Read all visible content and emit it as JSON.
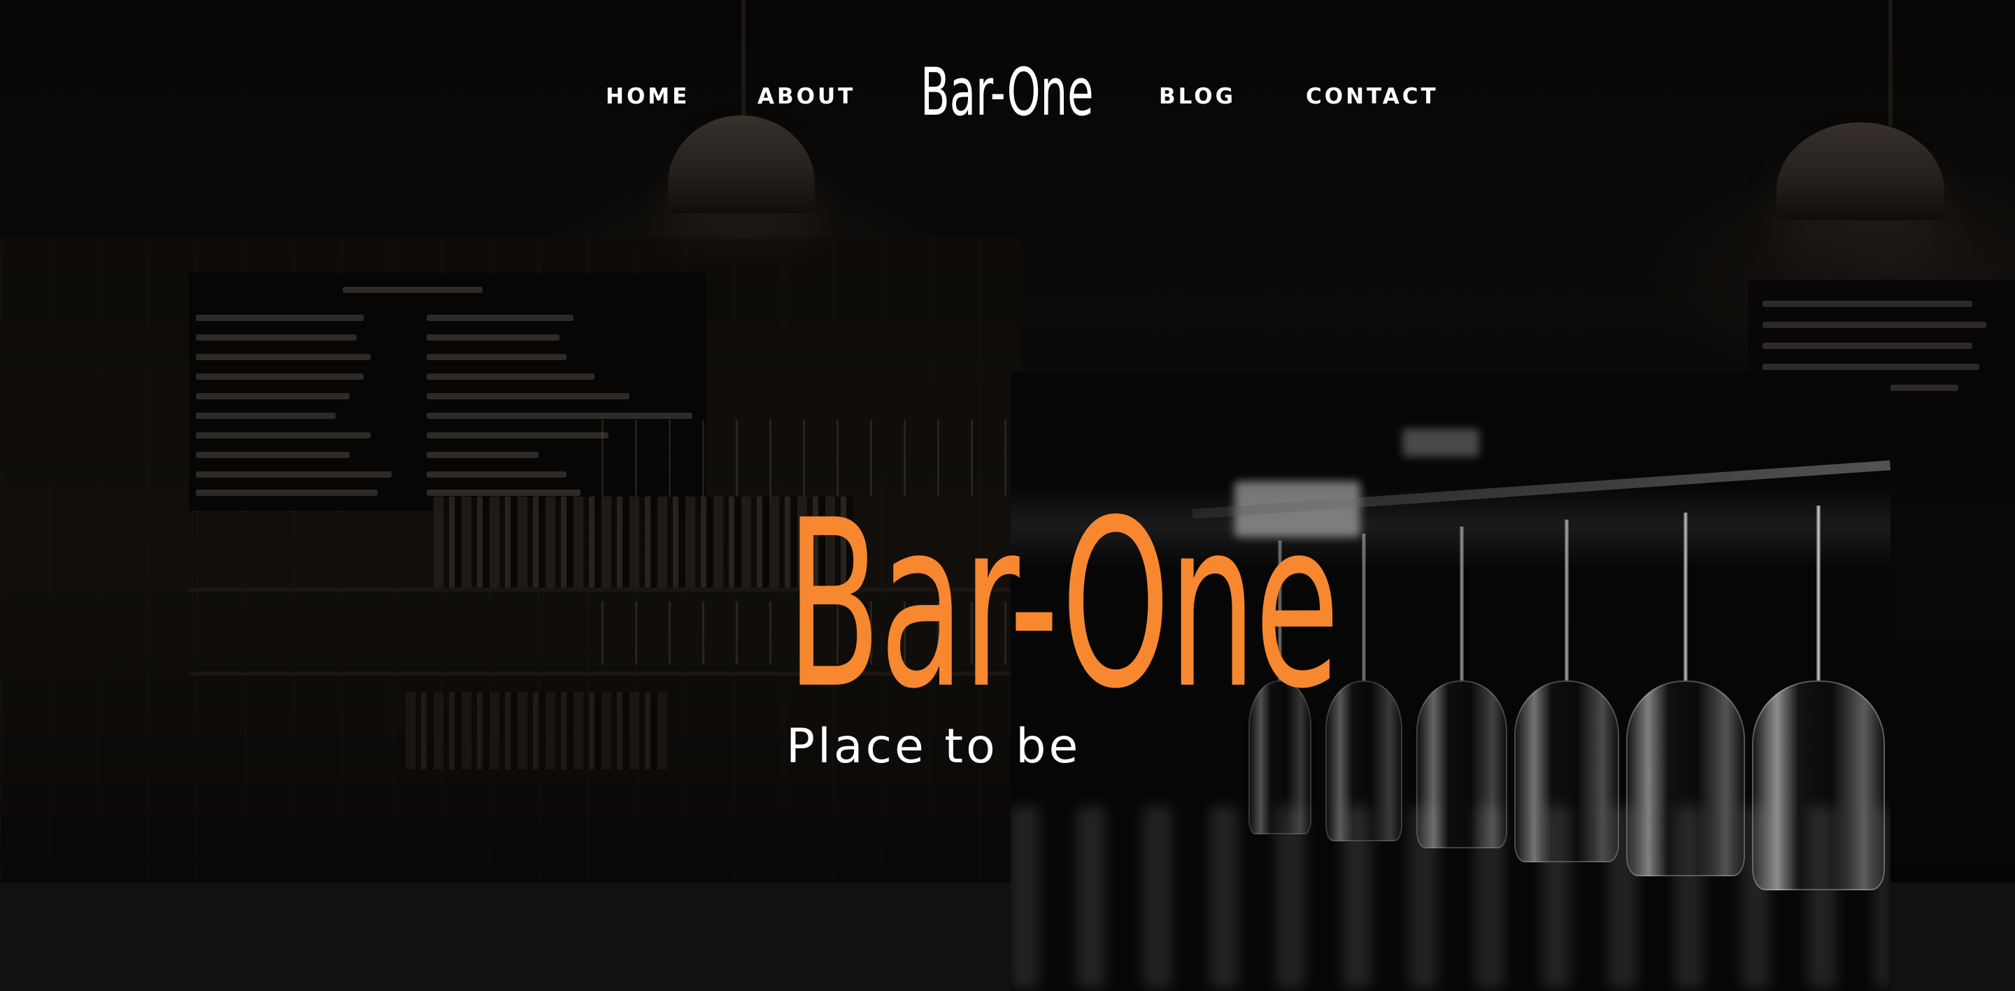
{
  "nav": {
    "home_label": "HOME",
    "about_label": "ABOUT",
    "logo_text": "Bar-One",
    "blog_label": "BLOG",
    "contact_label": "CONTACT"
  },
  "hero": {
    "title": "Bar-One",
    "tagline": "Place to be",
    "background_image": "bar-interior-photo",
    "panel_image": "hanging-wine-glasses-photo"
  },
  "colors": {
    "accent": "#f7882f",
    "text": "#ffffff",
    "background": "#050505",
    "lower_band": "#111111"
  }
}
